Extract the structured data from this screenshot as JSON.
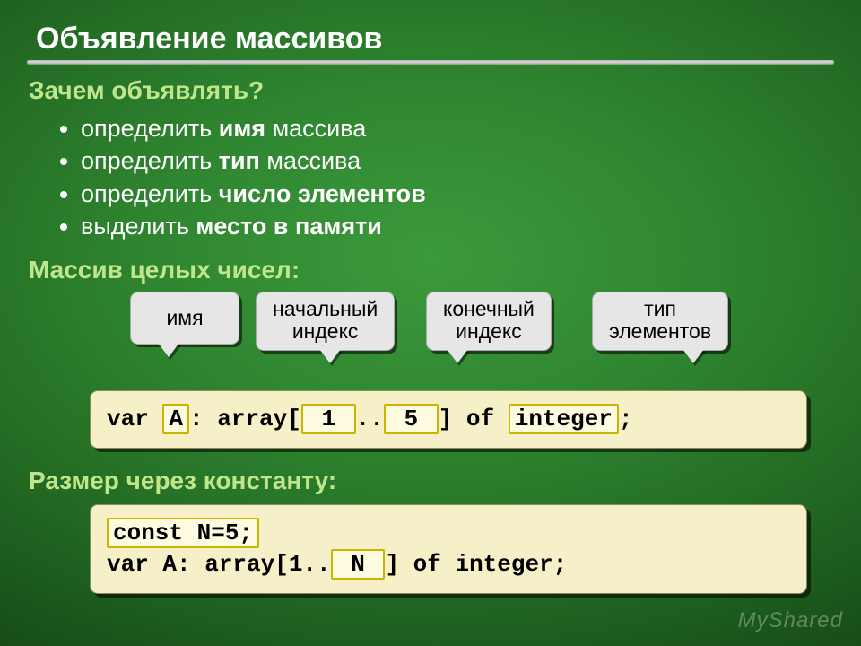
{
  "title": "Объявление массивов",
  "sec1": {
    "heading": "Зачем объявлять?",
    "items": [
      {
        "pre": "определить ",
        "emph": "имя",
        "post": " массива"
      },
      {
        "pre": "определить ",
        "emph": "тип",
        "post": " массива"
      },
      {
        "pre": "определить ",
        "emph": "число элементов",
        "post": ""
      },
      {
        "pre": "выделить ",
        "emph": "место в памяти",
        "post": ""
      }
    ]
  },
  "sec2": {
    "heading": "Массив целых чисел:"
  },
  "callouts": {
    "name": {
      "label": "имя"
    },
    "first": {
      "line1": "начальный",
      "line2": "индекс"
    },
    "last": {
      "line1": "конечный",
      "line2": "индекс"
    },
    "type": {
      "line1": "тип",
      "line2": "элементов"
    }
  },
  "code1": {
    "t0": "var ",
    "h1": "A",
    "t1": ": array[",
    "h2": " 1 ",
    "t2": "..",
    "h3": " 5 ",
    "t3": "] of ",
    "h4": "integer",
    "t4": ";"
  },
  "sec3": {
    "heading": "Размер через константу:"
  },
  "code2": {
    "hConst": "const N=5;",
    "t0": "var A: array[1..",
    "hN": " N ",
    "t1": "] of integer;"
  },
  "watermark": "MyShared"
}
